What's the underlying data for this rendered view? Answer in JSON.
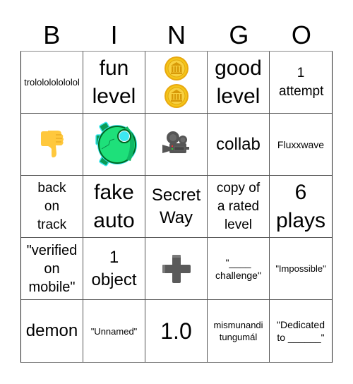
{
  "header": {
    "letters": [
      "B",
      "I",
      "N",
      "G",
      "O"
    ]
  },
  "card": {
    "rows": [
      [
        {
          "text": "trololololololol",
          "type": "text"
        },
        {
          "text": "fun level",
          "type": "text"
        },
        {
          "icon": "coin-icon",
          "count": 2,
          "type": "icon"
        },
        {
          "text": "good level",
          "type": "text"
        },
        {
          "text": "1 attempt",
          "type": "text"
        }
      ],
      [
        {
          "icon": "thumbs-down-icon",
          "type": "icon"
        },
        {
          "icon": "robot-ball-icon",
          "type": "icon"
        },
        {
          "icon": "movie-camera-icon",
          "type": "icon"
        },
        {
          "text": "collab",
          "type": "text"
        },
        {
          "text": "Fluxxwave",
          "type": "text"
        }
      ],
      [
        {
          "text": "back on track",
          "type": "text"
        },
        {
          "text": "fake auto",
          "type": "text"
        },
        {
          "text": "Secret Way",
          "type": "text"
        },
        {
          "text": "copy of a rated level",
          "type": "text"
        },
        {
          "text": "6 plays",
          "type": "text"
        }
      ],
      [
        {
          "text": "\"verified on mobile\"",
          "type": "text"
        },
        {
          "text": "1 object",
          "type": "text"
        },
        {
          "icon": "plus-icon",
          "type": "icon"
        },
        {
          "text": "\"____ challenge\"",
          "type": "text"
        },
        {
          "text": "\"Impossible\"",
          "type": "text"
        }
      ],
      [
        {
          "text": "demon",
          "type": "text"
        },
        {
          "text": "\"Unnamed\"",
          "type": "text"
        },
        {
          "text": "1.0",
          "type": "text"
        },
        {
          "text": "mismunandi tungumál",
          "type": "text"
        },
        {
          "text": "\"Dedicated to ______\"",
          "type": "text"
        }
      ]
    ]
  },
  "colors": {
    "coin_gold": "#F5C518",
    "robot_green": "#1EE07A",
    "robot_cyan": "#3DE8F0",
    "thumb_yellow": "#FFC83D",
    "camera_gray": "#555555",
    "plus_gray": "#5a5a5a"
  }
}
